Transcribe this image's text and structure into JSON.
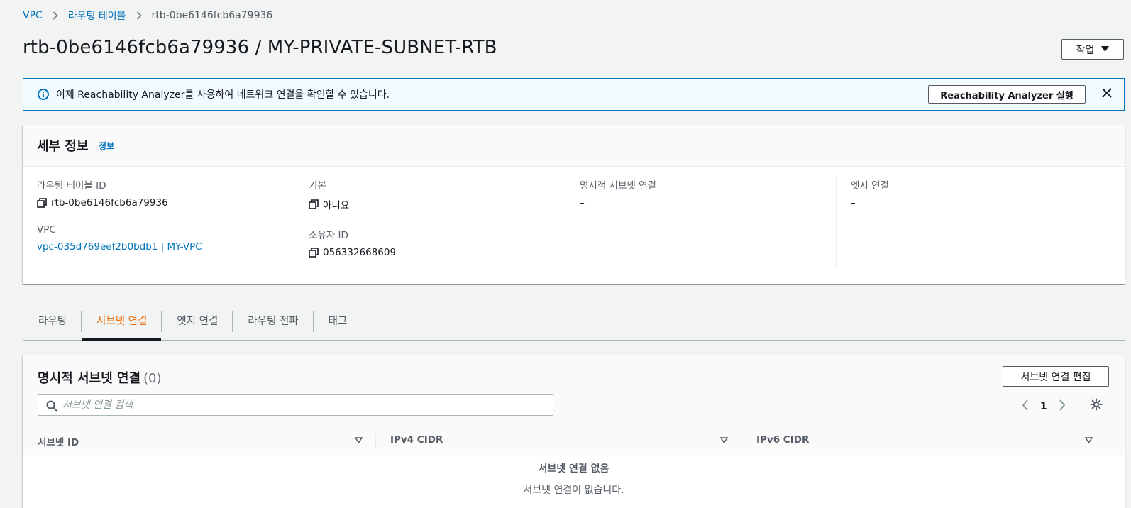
{
  "breadcrumb": {
    "items": [
      {
        "label": "VPC"
      },
      {
        "label": "라우팅 테이블"
      },
      {
        "label": "rtb-0be6146fcb6a79936"
      }
    ]
  },
  "header": {
    "title": "rtb-0be6146fcb6a79936 / MY-PRIVATE-SUBNET-RTB",
    "actions_label": "작업"
  },
  "flash": {
    "message": "이제 Reachability Analyzer를 사용하여 네트워크 연결을 확인할 수 있습니다.",
    "button_label": "Reachability Analyzer 실행"
  },
  "details": {
    "title": "세부 정보",
    "info_link": "정보",
    "route_table_id_label": "라우팅 테이블 ID",
    "route_table_id": "rtb-0be6146fcb6a79936",
    "vpc_label": "VPC",
    "vpc_value": "vpc-035d769eef2b0bdb1 | MY-VPC",
    "main_label": "기본",
    "main_value": "아니요",
    "owner_label": "소유자 ID",
    "owner_value": "056332668609",
    "explicit_label": "명시적 서브넷 연결",
    "explicit_value": "–",
    "edge_label": "엣지 연결",
    "edge_value": "–"
  },
  "tabs": [
    {
      "label": "라우팅",
      "active": false
    },
    {
      "label": "서브넷 연결",
      "active": true
    },
    {
      "label": "엣지 연결",
      "active": false
    },
    {
      "label": "라우팅 전파",
      "active": false
    },
    {
      "label": "태그",
      "active": false
    }
  ],
  "subnet_section": {
    "title": "명시적 서브넷 연결",
    "count": "(0)",
    "edit_button": "서브넷 연결 편집",
    "search_placeholder": "서브넷 연결 검색",
    "page": "1",
    "columns": [
      "서브넷 ID",
      "IPv4 CIDR",
      "IPv6 CIDR"
    ],
    "empty_title": "서브넷 연결 없음",
    "empty_message": "서브넷 연결이 없습니다."
  },
  "colors": {
    "link": "#0073bb",
    "accent": "#ec7211",
    "info_bg": "#f1faff"
  }
}
